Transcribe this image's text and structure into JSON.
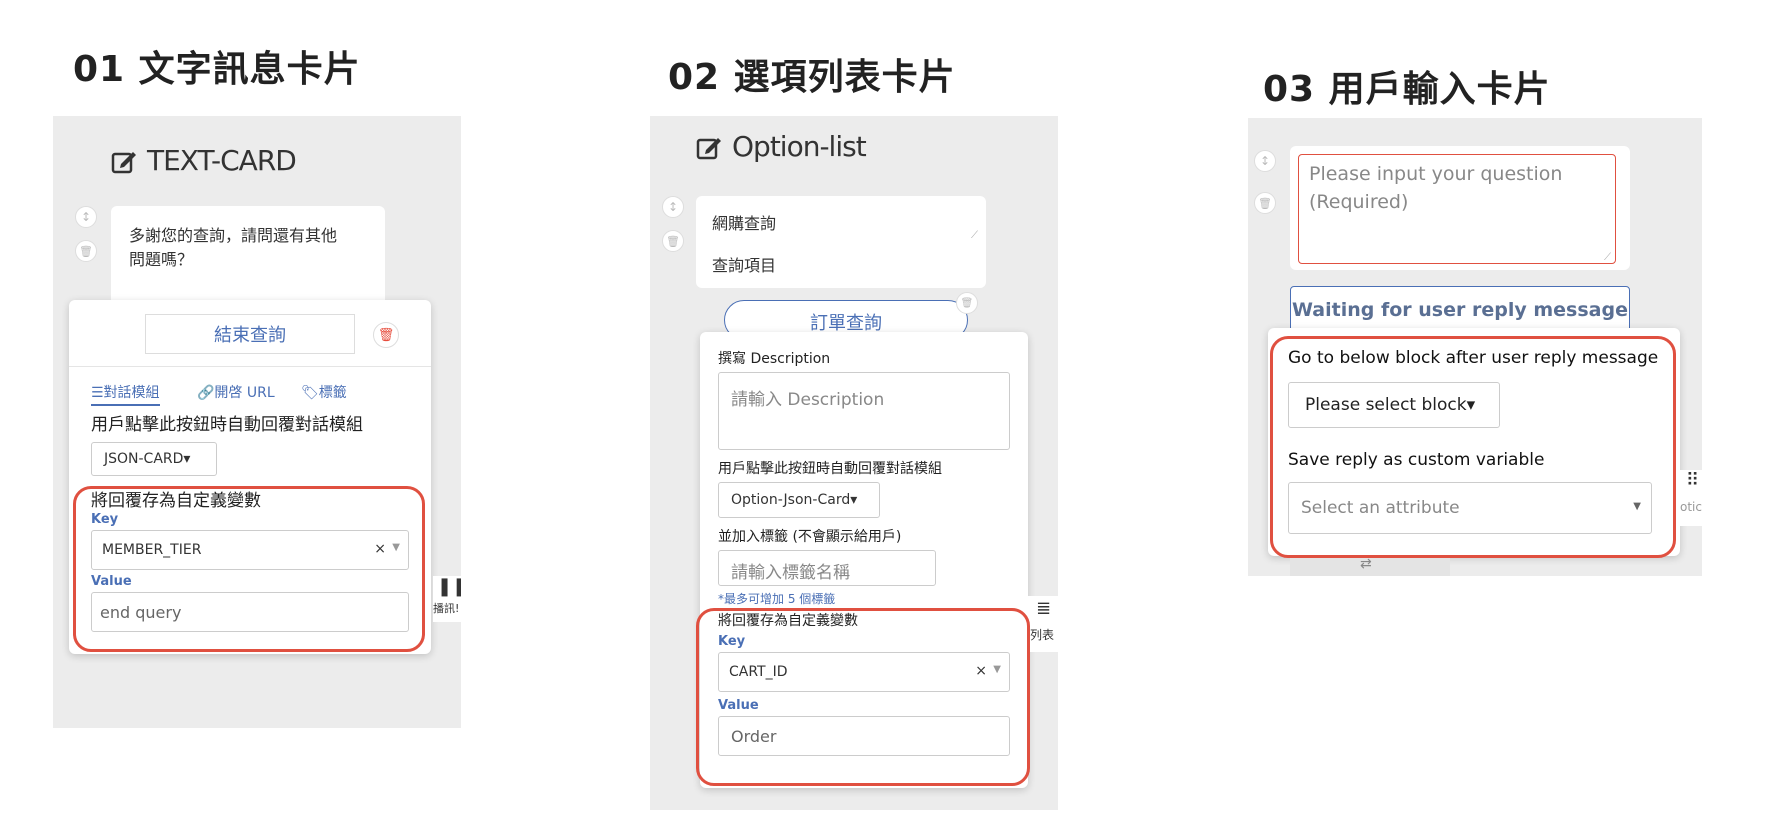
{
  "sections": [
    {
      "title": "01 文字訊息卡片"
    },
    {
      "title": "02 選項列表卡片"
    },
    {
      "title": "03 用戶輸入卡片"
    }
  ],
  "text_card": {
    "header": "TEXT-CARD",
    "message_line1": "多謝您的查詢，請問還有其他",
    "message_line2": "問題嗎？",
    "button_label": "結束查詢",
    "tabs": [
      "☰對話模組",
      "🔗開啓 URL",
      "🏷標籤"
    ],
    "reply_label": "用戶點擊此按鈕時自動回覆對話模組",
    "module_select": "JSON-CARD▾",
    "save_title": "將回覆存為自定義變數",
    "key_label": "Key",
    "key_value": "MEMBER_TIER",
    "value_label": "Value",
    "value_value": "end query",
    "side_label": "播訊!"
  },
  "option_list": {
    "header": "Option-list",
    "title_value": "網購查詢",
    "subtitle_value": "查詢項目",
    "option_button": "訂單查詢",
    "desc_label": "撰寫 Description",
    "desc_placeholder": "請輸入 Description",
    "reply_label": "用戶點擊此按鈕時自動回覆對話模組",
    "module_select": "Option-Json-Card▾",
    "tag_label": "並加入標籤 (不會顯示給用戶)",
    "tag_placeholder": "請輸入標籤名稱",
    "tag_hint": "*最多可增加 5 個標籤",
    "save_title": "將回覆存為自定義變數",
    "key_label": "Key",
    "key_value": "CART_ID",
    "value_label": "Value",
    "value_value": "Order",
    "side_label": "列表"
  },
  "user_input": {
    "question_placeholder_1": "Please input your question",
    "question_placeholder_2": "(Required)",
    "waiting_button": "Waiting for user reply message",
    "goto_label": "Go to below block after user reply message",
    "block_select": "Please select block▾",
    "save_label": "Save reply as custom variable",
    "attribute_placeholder": "Select an attribute",
    "side_label": "otic"
  },
  "colors": {
    "accent": "#4a6fb5",
    "highlight": "#e05040",
    "panel": "#ececec",
    "danger": "#e74c3c"
  }
}
